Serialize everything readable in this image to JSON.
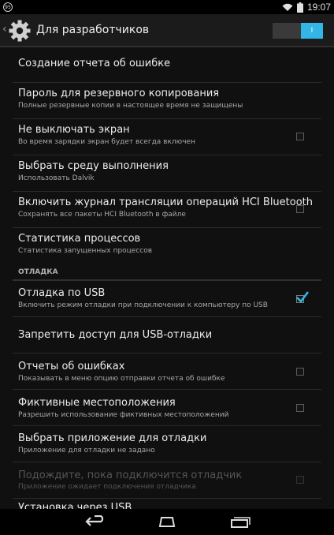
{
  "status_bar": {
    "badge": "95",
    "time": "19:07",
    "icons": [
      "notification-badge-icon",
      "wifi-icon",
      "battery-icon"
    ]
  },
  "action_bar": {
    "title": "Для разработчиков",
    "toggle_label": "I",
    "toggle_on": true,
    "accent_color": "#33b5e5"
  },
  "items": [
    {
      "title": "Создание отчета об ошибке",
      "subtitle": "",
      "checkbox": null
    },
    {
      "title": "Пароль для резервного копирования",
      "subtitle": "Полные резервные копии в настоящее время не защищены",
      "checkbox": null
    },
    {
      "title": "Не выключать экран",
      "subtitle": "Во время зарядки экран будет всегда включен",
      "checkbox": false
    },
    {
      "title": "Выбрать среду выполнения",
      "subtitle": "Использовать Dalvik",
      "checkbox": null
    },
    {
      "title": "Включить журнал трансляции операций HCI Bluetooth",
      "subtitle": "Сохранять все пакеты HCI Bluetooth в файле",
      "checkbox": false
    },
    {
      "title": "Статистика процессов",
      "subtitle": "Статистика запущенных процессов",
      "checkbox": null
    }
  ],
  "debug_section": {
    "header": "ОТЛАДКА",
    "items": [
      {
        "title": "Отладка по USB",
        "subtitle": "Включить режим отладки при подключении к компьютеру по USB",
        "checkbox": true
      },
      {
        "title": "Запретить доступ для USB-отладки",
        "subtitle": "",
        "checkbox": null
      },
      {
        "title": "Отчеты об ошибках",
        "subtitle": "Показывать в меню опцию отправки отчета об ошибке",
        "checkbox": false
      },
      {
        "title": "Фиктивные местоположения",
        "subtitle": "Разрешить использование фиктивных местоположений",
        "checkbox": false
      },
      {
        "title": "Выбрать приложение для отладки",
        "subtitle": "Приложение для отладки не задано",
        "checkbox": null
      },
      {
        "title": "Подождите, пока подключится отладчик",
        "subtitle": "Приложение ожидает подключения отладчика",
        "checkbox": false,
        "disabled": true
      },
      {
        "title": "Установка через USB",
        "subtitle": "",
        "checkbox": null
      }
    ]
  },
  "nav_bar": {
    "buttons": [
      "back-icon",
      "home-icon",
      "recents-icon"
    ]
  }
}
